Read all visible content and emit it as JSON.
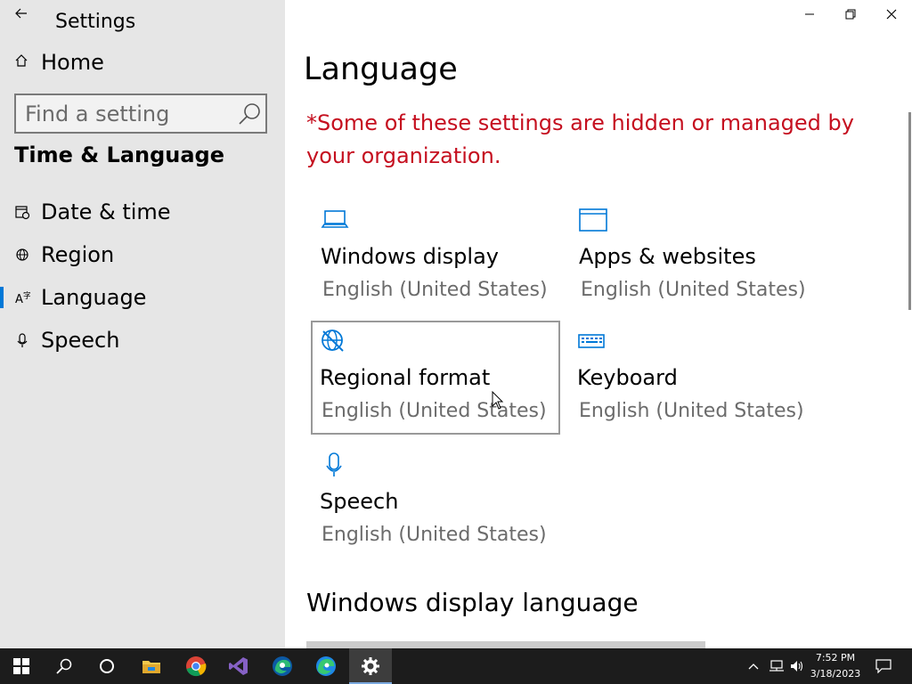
{
  "window": {
    "title": "Settings",
    "minimize_icon": "minimize-icon",
    "maximize_icon": "restore-icon",
    "close_icon": "close-icon"
  },
  "sidebar": {
    "back_icon": "back-arrow-icon",
    "home_label": "Home",
    "search_placeholder": "Find a setting",
    "section_title": "Time & Language",
    "items": [
      {
        "label": "Date & time",
        "icon": "calendar-clock-icon",
        "active": false
      },
      {
        "label": "Region",
        "icon": "globe-icon",
        "active": false
      },
      {
        "label": "Language",
        "icon": "language-icon",
        "active": true
      },
      {
        "label": "Speech",
        "icon": "microphone-icon",
        "active": false
      }
    ]
  },
  "main": {
    "title": "Language",
    "warning": "*Some of these settings are hidden or managed by your organization.",
    "tiles": [
      {
        "name": "Windows display",
        "value": "English (United States)",
        "icon": "laptop-icon"
      },
      {
        "name": "Apps & websites",
        "value": "English (United States)",
        "icon": "window-icon"
      },
      {
        "name": "Regional format",
        "value": "English (United States)",
        "icon": "globe-format-icon"
      },
      {
        "name": "Keyboard",
        "value": "English (United States)",
        "icon": "keyboard-icon"
      },
      {
        "name": "Speech",
        "value": "English (United States)",
        "icon": "microphone-icon"
      }
    ],
    "section_heading": "Windows display language"
  },
  "taskbar": {
    "apps": [
      "start-icon",
      "search-icon",
      "cortana-icon",
      "file-explorer-icon",
      "chrome-icon",
      "visual-studio-icon",
      "edge-dev-icon",
      "edge-icon",
      "settings-icon"
    ],
    "time": "7:52 PM",
    "date": "3/18/2023"
  },
  "colors": {
    "accent": "#0078d7",
    "warning": "#c50f1f",
    "sidebar_bg": "#e6e6e6",
    "taskbar_bg": "#1c1c1c"
  }
}
